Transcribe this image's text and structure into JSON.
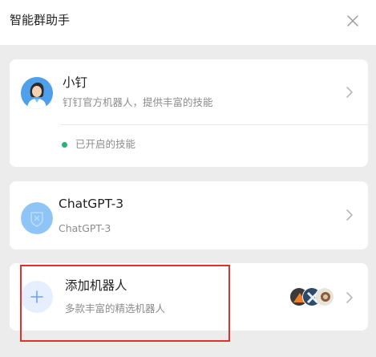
{
  "header": {
    "title": "智能群助手"
  },
  "icons": {
    "close": "close-icon",
    "chevron": "chevron-right-icon",
    "add": "plus-icon"
  },
  "colors": {
    "status_on": "#22b573",
    "highlight": "#e0322b",
    "add_icon": "#6aa2ff"
  },
  "cards": [
    {
      "name": "小钉",
      "description": "钉钉官方机器人，提供丰富的技能",
      "status": "已开启的技能"
    },
    {
      "name": "ChatGPT-3",
      "description": "ChatGPT-3"
    },
    {
      "name": "添加机器人",
      "description": "多款丰富的精选机器人"
    }
  ]
}
